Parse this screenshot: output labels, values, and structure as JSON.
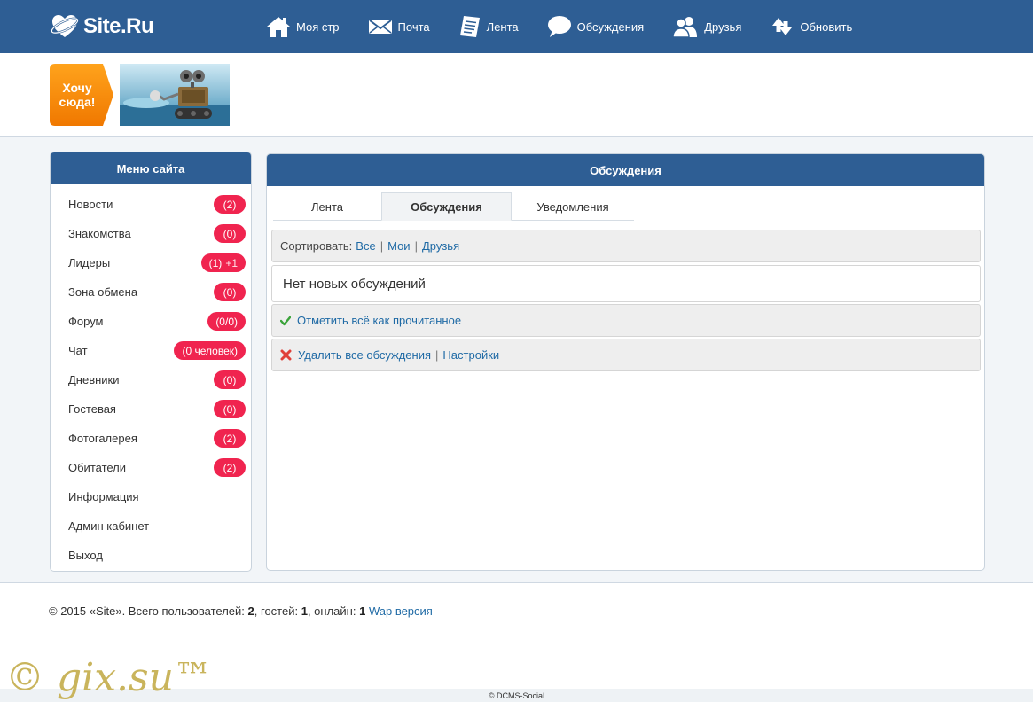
{
  "header": {
    "logo_text": "Site.Ru",
    "nav": [
      {
        "label": "Моя стр",
        "icon": "home-icon"
      },
      {
        "label": "Почта",
        "icon": "envelope-icon"
      },
      {
        "label": "Лента",
        "icon": "feed-icon"
      },
      {
        "label": "Обсуждения",
        "icon": "speech-bubble-icon"
      },
      {
        "label": "Друзья",
        "icon": "friends-icon"
      },
      {
        "label": "Обновить",
        "icon": "refresh-icon"
      }
    ],
    "bg_color": "#2e5e94"
  },
  "banner": {
    "want_line1": "Хочу",
    "want_line2": "сюда!"
  },
  "sidebar": {
    "title": "Меню сайта",
    "items": [
      {
        "label": "Новости",
        "badge": "(2)"
      },
      {
        "label": "Знакомства",
        "badge": "(0)"
      },
      {
        "label": "Лидеры",
        "badge": "(1)",
        "badge_extra": "+1"
      },
      {
        "label": "Зона обмена",
        "badge": "(0)"
      },
      {
        "label": "Форум",
        "badge": "(0/0)"
      },
      {
        "label": "Чат",
        "badge": "(0 человек)"
      },
      {
        "label": "Дневники",
        "badge": "(0)"
      },
      {
        "label": "Гостевая",
        "badge": "(0)"
      },
      {
        "label": "Фотогалерея",
        "badge": "(2)"
      },
      {
        "label": "Обитатели",
        "badge": "(2)"
      },
      {
        "label": "Информация"
      },
      {
        "label": "Админ кабинет"
      },
      {
        "label": "Выход"
      }
    ],
    "badge_color": "#f0244f"
  },
  "main": {
    "title": "Обсуждения",
    "tabs": [
      {
        "label": "Лента"
      },
      {
        "label": "Обсуждения"
      },
      {
        "label": "Уведомления"
      }
    ],
    "sort": {
      "label": "Сортировать:",
      "options": [
        "Все",
        "Мои",
        "Друзья"
      ]
    },
    "empty_message": "Нет новых обсуждений",
    "mark_read": "Отметить всё как прочитанное",
    "delete_all": "Удалить все обсуждения",
    "settings": "Настройки"
  },
  "footer": {
    "copyright": "© 2015 «Site». Всего пользователей:",
    "users": "2",
    "guests_label": ", гостей:",
    "guests": "1",
    "online_label": ", онлайн:",
    "online": "1",
    "wap_link": "Wap версия",
    "watermark": "© gix.su™",
    "credit": "© DCMS-Social"
  }
}
